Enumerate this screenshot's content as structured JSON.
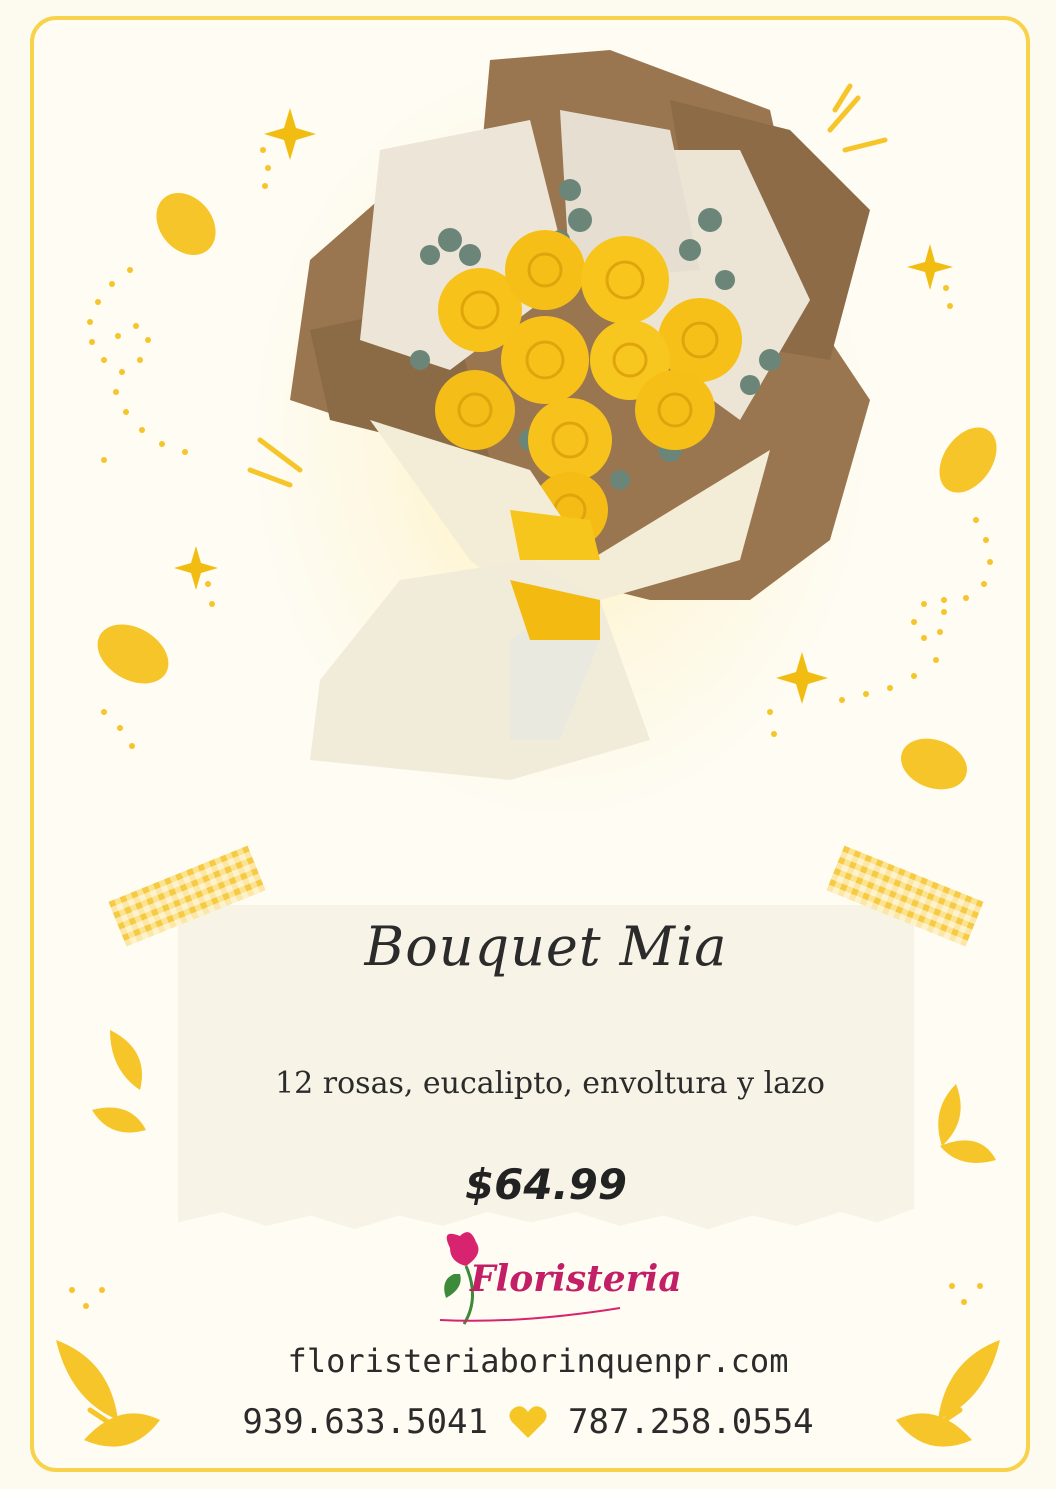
{
  "product": {
    "name": "Bouquet Mia",
    "description": "12 rosas, eucalipto, envoltura y lazo",
    "price": "$64.99"
  },
  "brand": {
    "logo_text": "Floristeria"
  },
  "contact": {
    "website": "floristeriaborinquenpr.com",
    "phone_1": "939.633.5041",
    "phone_2": "787.258.0554",
    "separator_icon": "yellow-heart-icon"
  },
  "colors": {
    "accent": "#f7d24a",
    "rose": "#f7c31b",
    "logo": "#c21f66"
  }
}
